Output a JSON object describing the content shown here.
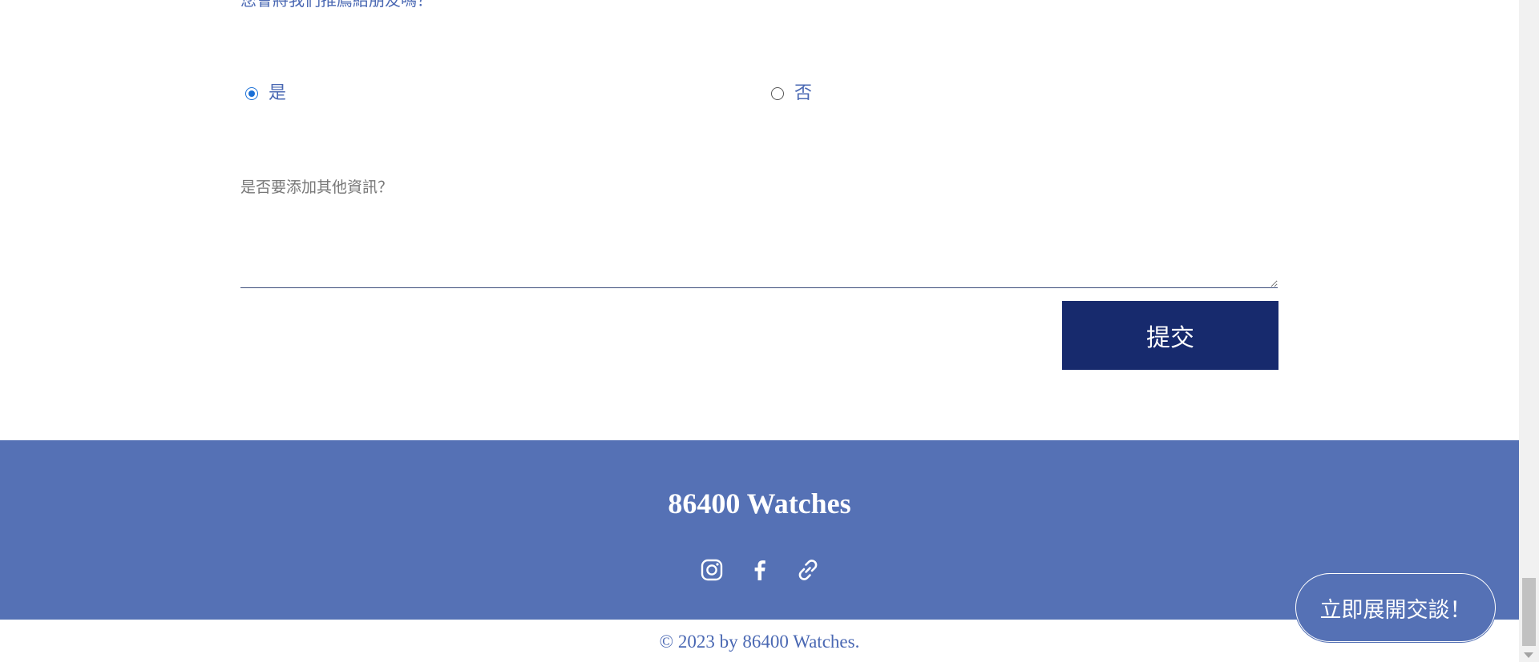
{
  "form": {
    "question_label": "您會將我們推薦給朋友嗎？",
    "options": [
      {
        "label": "是",
        "checked": true
      },
      {
        "label": "否",
        "checked": false
      }
    ],
    "extra_label": "是否要添加其他資訊？",
    "extra_value": "",
    "submit_label": "提交"
  },
  "footer": {
    "brand": "86400 Watches",
    "social": [
      {
        "icon": "instagram-icon"
      },
      {
        "icon": "facebook-icon"
      },
      {
        "icon": "link-icon"
      }
    ],
    "copyright": "© 2023 by 86400 Watches."
  },
  "chat": {
    "label": "立即展開交談！"
  },
  "colors": {
    "primary_dark": "#172a6d",
    "footer_bg": "#5571b5",
    "text_blue": "#4a68b3",
    "radio_accent": "#1a6fd6"
  }
}
